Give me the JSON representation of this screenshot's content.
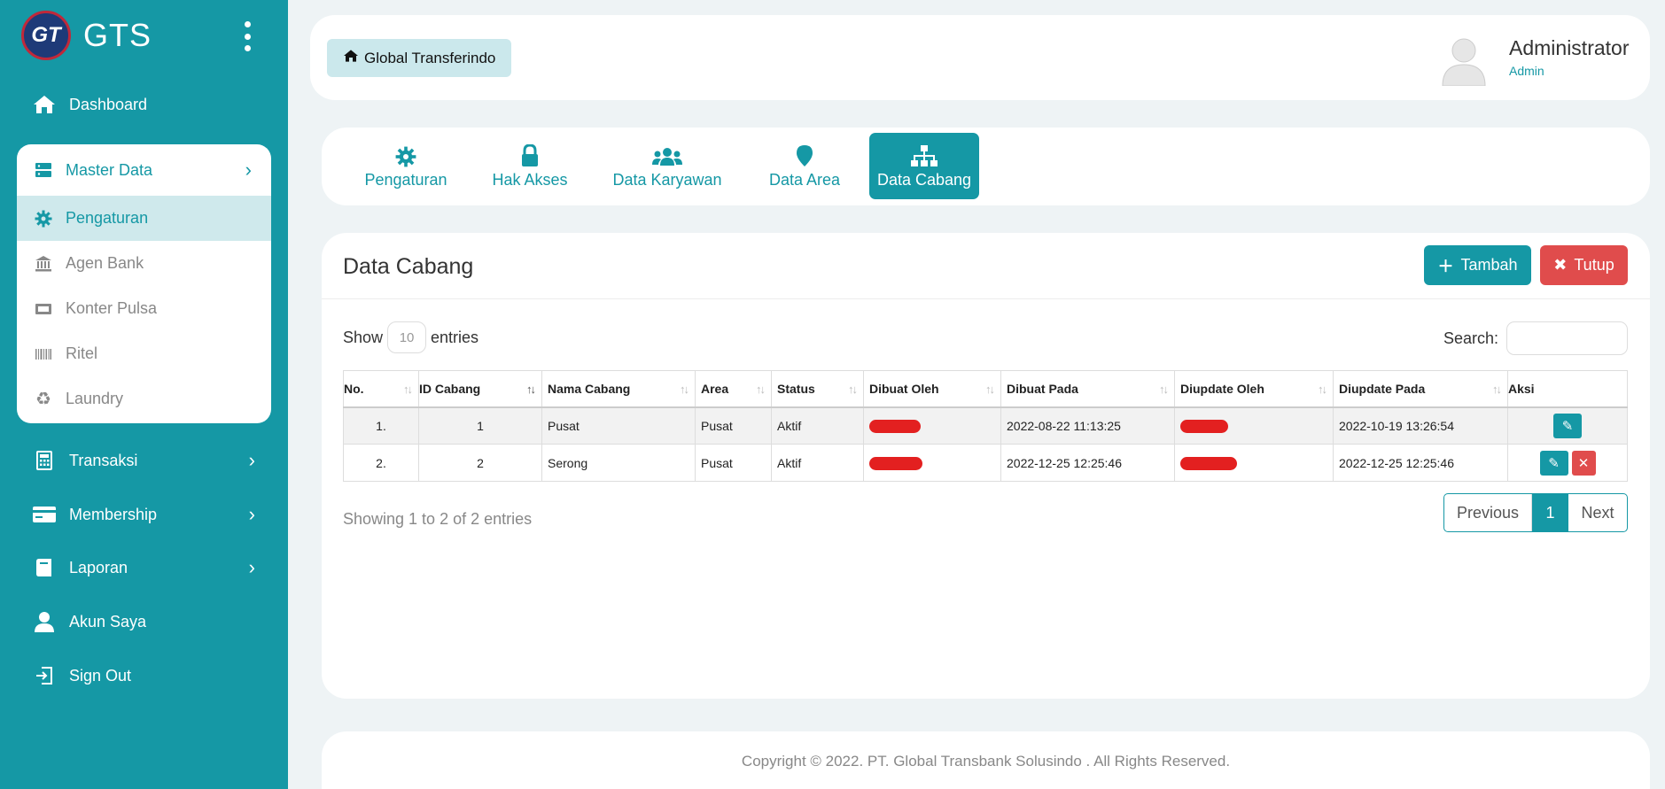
{
  "brand": {
    "name": "GTS",
    "logo_text": "GT"
  },
  "sidebar": {
    "items": [
      {
        "label": "Dashboard",
        "icon": "home-icon"
      },
      {
        "label": "Transaksi",
        "icon": "calculator-icon"
      },
      {
        "label": "Membership",
        "icon": "credit-card-icon"
      },
      {
        "label": "Laporan",
        "icon": "book-icon"
      },
      {
        "label": "Akun Saya",
        "icon": "user-icon"
      },
      {
        "label": "Sign Out",
        "icon": "sign-out-icon"
      }
    ],
    "master": {
      "label": "Master Data",
      "icon": "server-icon",
      "items": [
        {
          "label": "Pengaturan",
          "icon": "gear-icon",
          "active": true
        },
        {
          "label": "Agen Bank",
          "icon": "bank-icon"
        },
        {
          "label": "Konter Pulsa",
          "icon": "ticket-icon"
        },
        {
          "label": "Ritel",
          "icon": "barcode-icon"
        },
        {
          "label": "Laundry",
          "icon": "recycle-icon"
        }
      ]
    }
  },
  "header": {
    "home_label": "Global Transferindo",
    "user_name": "Administrator",
    "user_role": "Admin"
  },
  "tabs": [
    {
      "label": "Pengaturan",
      "icon": "gear-icon"
    },
    {
      "label": "Hak Akses",
      "icon": "lock-icon"
    },
    {
      "label": "Data Karyawan",
      "icon": "users-icon"
    },
    {
      "label": "Data Area",
      "icon": "map-pin-icon"
    },
    {
      "label": "Data Cabang",
      "icon": "sitemap-icon",
      "active": true
    }
  ],
  "content": {
    "title": "Data Cabang",
    "add_label": "Tambah",
    "close_label": "Tutup",
    "show_label": "Show",
    "entries_label": "entries",
    "page_length": "10",
    "search_label": "Search:",
    "info": "Showing 1 to 2 of 2 entries",
    "pager": {
      "prev": "Previous",
      "current": "1",
      "next": "Next"
    }
  },
  "table": {
    "columns": [
      "No.",
      "ID Cabang",
      "Nama Cabang",
      "Area",
      "Status",
      "Dibuat Oleh",
      "Dibuat Pada",
      "Diupdate Oleh",
      "Diupdate Pada",
      "Aksi"
    ],
    "rows": [
      {
        "no": "1.",
        "id": "1",
        "nama": "Pusat",
        "area": "Pusat",
        "status": "Aktif",
        "dibuat_pada": "2022-08-22 11:13:25",
        "diupdate_pada": "2022-10-19 13:26:54"
      },
      {
        "no": "2.",
        "id": "2",
        "nama": "Serong",
        "area": "Pusat",
        "status": "Aktif",
        "dibuat_pada": "2022-12-25 12:25:46",
        "diupdate_pada": "2022-12-25 12:25:46"
      }
    ]
  },
  "footer": {
    "copyright": "Copyright © 2022. PT. Global Transbank Solusindo . All Rights Reserved."
  },
  "colors": {
    "primary": "#1598a5",
    "danger": "#e04c4c",
    "active_bg": "#cfe9ec",
    "redaction": "#e32020"
  }
}
